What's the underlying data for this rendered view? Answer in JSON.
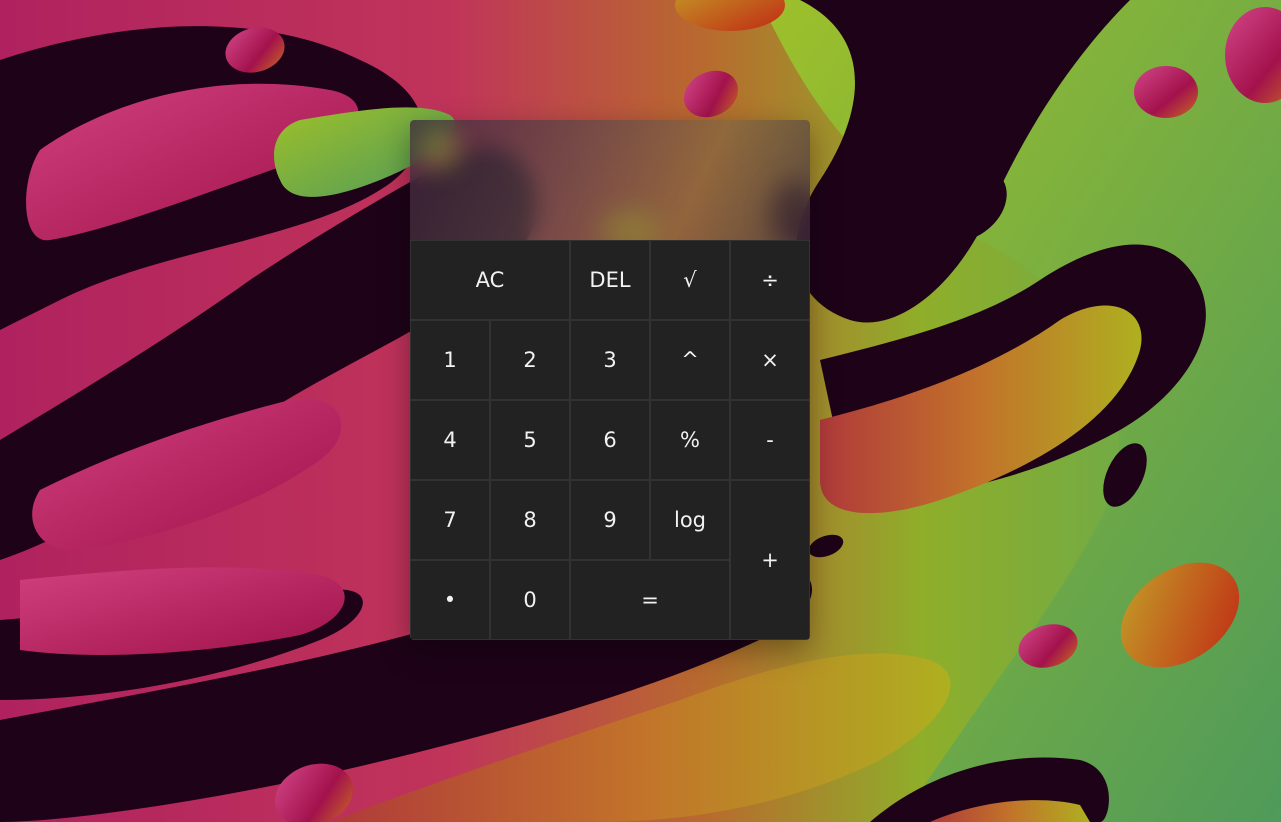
{
  "colors": {
    "key_bg": "#222222",
    "key_border": "#333333",
    "key_text": "#f2f2f2"
  },
  "display": {
    "value": ""
  },
  "keys": [
    {
      "name": "clear-all-button",
      "label": "AC"
    },
    {
      "name": "delete-button",
      "label": "DEL"
    },
    {
      "name": "sqrt-button",
      "label": "√"
    },
    {
      "name": "divide-button",
      "label": "÷"
    },
    {
      "name": "digit-1-button",
      "label": "1"
    },
    {
      "name": "digit-2-button",
      "label": "2"
    },
    {
      "name": "digit-3-button",
      "label": "3"
    },
    {
      "name": "power-button",
      "label": "^"
    },
    {
      "name": "multiply-button",
      "label": "×"
    },
    {
      "name": "digit-4-button",
      "label": "4"
    },
    {
      "name": "digit-5-button",
      "label": "5"
    },
    {
      "name": "digit-6-button",
      "label": "6"
    },
    {
      "name": "percent-button",
      "label": "%"
    },
    {
      "name": "subtract-button",
      "label": "-"
    },
    {
      "name": "digit-7-button",
      "label": "7"
    },
    {
      "name": "digit-8-button",
      "label": "8"
    },
    {
      "name": "digit-9-button",
      "label": "9"
    },
    {
      "name": "log-button",
      "label": "log"
    },
    {
      "name": "add-button",
      "label": "+"
    },
    {
      "name": "decimal-button",
      "label": "•"
    },
    {
      "name": "digit-0-button",
      "label": "0"
    },
    {
      "name": "equals-button",
      "label": "="
    }
  ]
}
